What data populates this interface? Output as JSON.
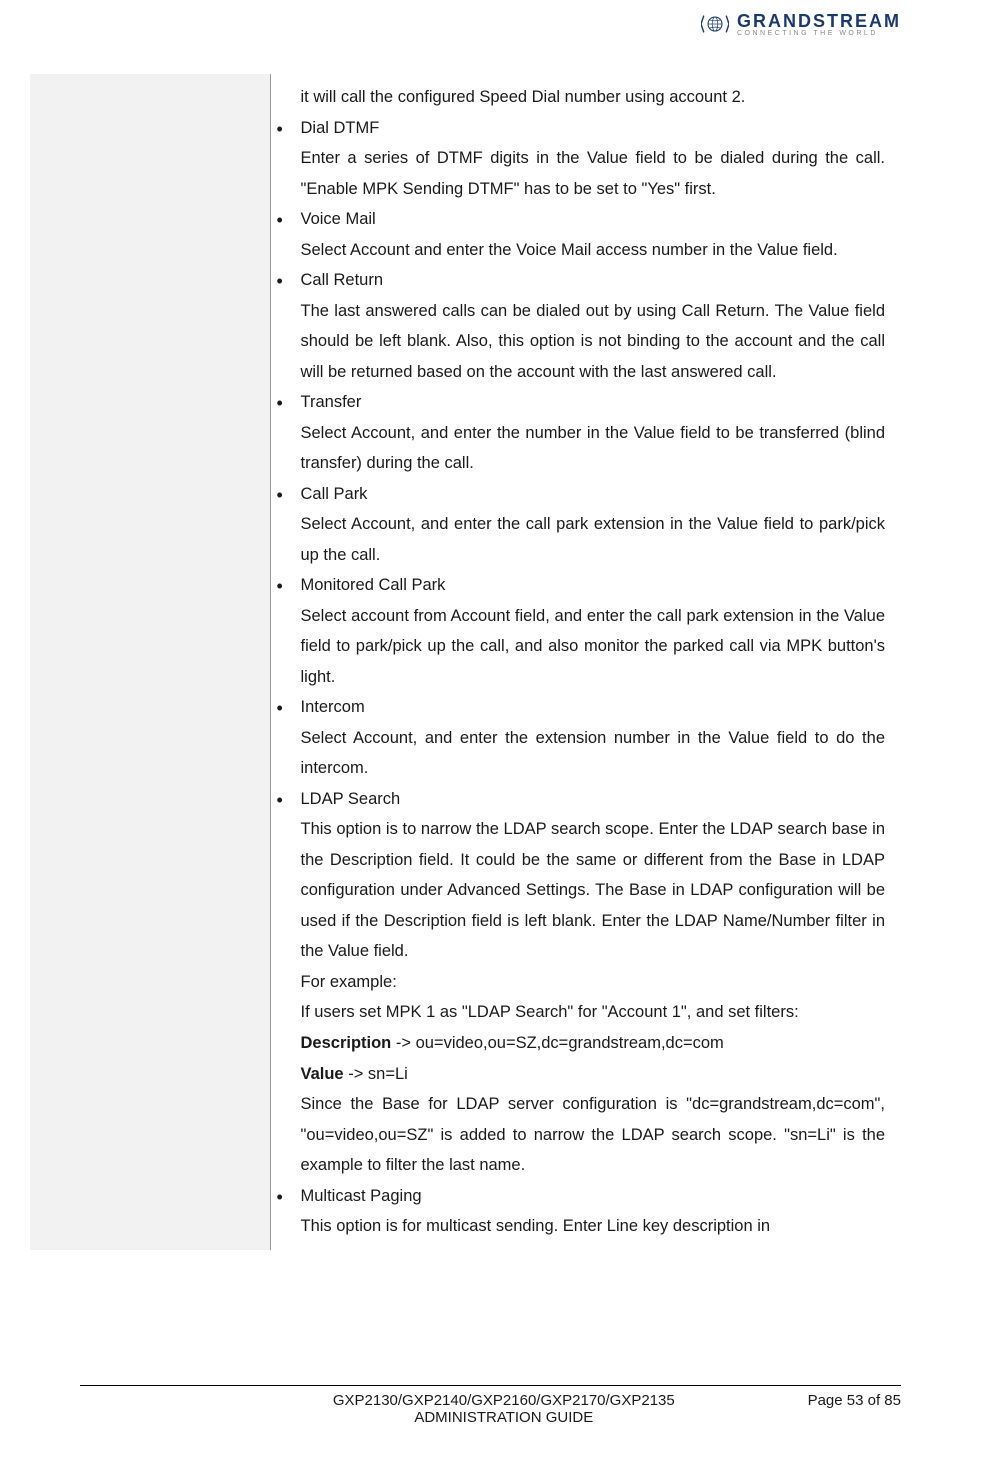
{
  "logo": {
    "main": "GRANDSTREAM",
    "sub": "CONNECTING THE WORLD"
  },
  "intro": "it will call the configured Speed Dial number using account 2.",
  "items": [
    {
      "title": "Dial DTMF",
      "desc": "Enter a series of DTMF digits in the Value field to be dialed during the call. \"Enable MPK Sending DTMF\" has to be set to \"Yes\" first."
    },
    {
      "title": "Voice Mail",
      "desc": "Select Account and enter the Voice Mail access number in the Value field."
    },
    {
      "title": "Call Return",
      "desc": "The last answered calls can be dialed out by using Call Return. The Value field should be left blank. Also, this option is not binding to the account and the call will be returned based on the account with the last answered call."
    },
    {
      "title": "Transfer",
      "desc": "Select Account, and enter the number in the Value field to be transferred (blind transfer) during the call."
    },
    {
      "title": "Call Park",
      "desc": "Select Account, and enter the call park extension in the Value field to park/pick up the call."
    },
    {
      "title": "Monitored Call Park",
      "desc": "Select account from Account field, and enter the call park extension in the Value field to park/pick up the call, and also monitor the parked call via MPK button's light."
    },
    {
      "title": "Intercom",
      "desc": "Select Account, and enter the extension number in the Value field to do the intercom."
    },
    {
      "title": "LDAP Search",
      "desc_lines": {
        "p1": "This option is to narrow the LDAP search scope. Enter the LDAP search base in the Description field. It could be the same or different from the Base in LDAP configuration under Advanced Settings. The Base in LDAP configuration will be used if the Description field is left blank. Enter the LDAP Name/Number filter in the Value field.",
        "p2": "For example:",
        "p3": "If users set MPK 1 as \"LDAP Search\" for \"Account 1\", and set filters:",
        "p4_label": "Description",
        "p4_text": " -> ou=video,ou=SZ,dc=grandstream,dc=com",
        "p5_label": "Value",
        "p5_text": " -> sn=Li",
        "p6": "Since the Base for LDAP server configuration is \"dc=grandstream,dc=com\", \"ou=video,ou=SZ\" is added to narrow the LDAP search scope. \"sn=Li\" is the example to filter the last name."
      }
    },
    {
      "title": "Multicast Paging",
      "desc": "This option is for multicast sending. Enter Line key description in"
    }
  ],
  "footer": {
    "left_line1": "GXP2130/GXP2140/GXP2160/GXP2170/GXP2135",
    "left_line2": "ADMINISTRATION GUIDE",
    "right": "Page 53 of 85"
  }
}
